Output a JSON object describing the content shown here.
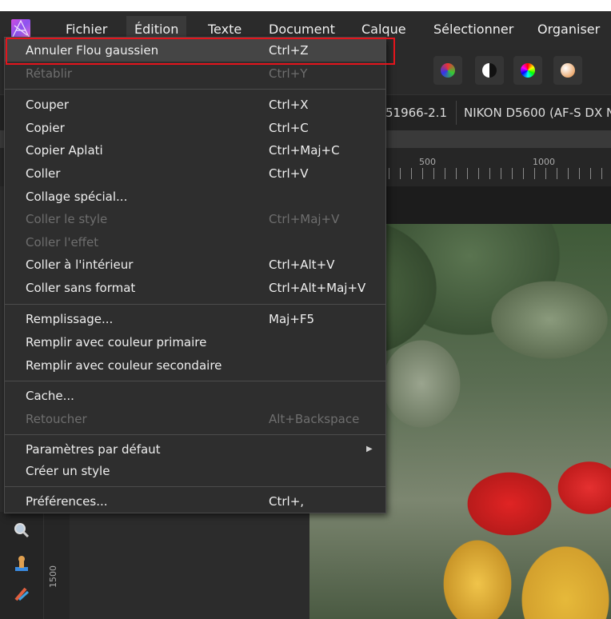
{
  "menubar": {
    "items": [
      "Fichier",
      "Édition",
      "Texte",
      "Document",
      "Calque",
      "Sélectionner",
      "Organiser"
    ]
  },
  "infobar": {
    "lens_id": "51966-2.1",
    "camera": "NIKON D5600 (AF-S DX N"
  },
  "ruler": {
    "h_labels": [
      "500",
      "1000"
    ],
    "v_label": "1500"
  },
  "menu": {
    "items": [
      {
        "label": "Annuler Flou gaussien",
        "shortcut": "Ctrl+Z",
        "enabled": true,
        "highlighted": true
      },
      {
        "label": "Rétablir",
        "shortcut": "Ctrl+Y",
        "enabled": false
      },
      {
        "label": "Couper",
        "shortcut": "Ctrl+X",
        "enabled": true
      },
      {
        "label": "Copier",
        "shortcut": "Ctrl+C",
        "enabled": true
      },
      {
        "label": "Copier Aplati",
        "shortcut": "Ctrl+Maj+C",
        "enabled": true
      },
      {
        "label": "Coller",
        "shortcut": "Ctrl+V",
        "enabled": true
      },
      {
        "label": "Collage spécial...",
        "shortcut": "",
        "enabled": true
      },
      {
        "label": "Coller le style",
        "shortcut": "Ctrl+Maj+V",
        "enabled": false
      },
      {
        "label": "Coller l'effet",
        "shortcut": "",
        "enabled": false
      },
      {
        "label": "Coller à l'intérieur",
        "shortcut": "Ctrl+Alt+V",
        "enabled": true
      },
      {
        "label": "Coller sans format",
        "shortcut": "Ctrl+Alt+Maj+V",
        "enabled": true
      },
      {
        "label": "Remplissage...",
        "shortcut": "Maj+F5",
        "enabled": true
      },
      {
        "label": "Remplir avec couleur primaire",
        "shortcut": "",
        "enabled": true
      },
      {
        "label": "Remplir avec couleur secondaire",
        "shortcut": "",
        "enabled": true
      },
      {
        "label": "Cache...",
        "shortcut": "",
        "enabled": true
      },
      {
        "label": "Retoucher",
        "shortcut": "Alt+Backspace",
        "enabled": false
      },
      {
        "label": "Paramètres par défaut",
        "shortcut": "",
        "enabled": true,
        "submenu": true
      },
      {
        "label": "Créer un style",
        "shortcut": "",
        "enabled": true
      },
      {
        "label": "Préférences...",
        "shortcut": "Ctrl+,",
        "enabled": true
      }
    ]
  },
  "colors": {
    "highlight_border": "#e4141c",
    "menu_bg": "#2e2e2e",
    "disabled_text": "#6e6e6e"
  },
  "icons": [
    "affinity-photo-logo-icon",
    "color-wheel-icons",
    "zoom-icon",
    "stamp-icon",
    "brush-icon"
  ]
}
